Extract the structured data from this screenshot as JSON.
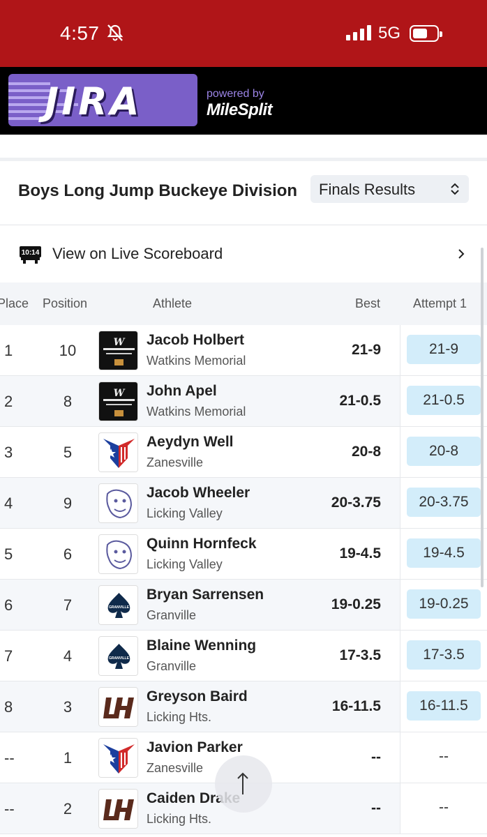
{
  "status_bar": {
    "time": "4:57",
    "network": "5G"
  },
  "brand": {
    "logo_text": "JIRA",
    "powered_by": "powered by",
    "partner": "MileSplit"
  },
  "event": {
    "title": "Boys Long Jump Buckeye Division",
    "result_type": "Finals Results",
    "live_scoreboard": {
      "label": "View on Live Scoreboard",
      "icon_time": "10:14"
    }
  },
  "table": {
    "headers": {
      "place": "Place",
      "position": "Position",
      "athlete": "Athlete",
      "best": "Best",
      "attempt": "Attempt 1"
    },
    "rows": [
      {
        "place": "1",
        "position": "10",
        "name": "Jacob Holbert",
        "team": "Watkins Memorial",
        "best": "21-9",
        "attempt": "21-9",
        "logo": "warriors-logo"
      },
      {
        "place": "2",
        "position": "8",
        "name": "John Apel",
        "team": "Watkins Memorial",
        "best": "21-0.5",
        "attempt": "21-0.5",
        "logo": "warriors-logo"
      },
      {
        "place": "3",
        "position": "5",
        "name": "Aeydyn Well",
        "team": "Zanesville",
        "best": "20-8",
        "attempt": "20-8",
        "logo": "zanesville-logo"
      },
      {
        "place": "4",
        "position": "9",
        "name": "Jacob Wheeler",
        "team": "Licking Valley",
        "best": "20-3.75",
        "attempt": "20-3.75",
        "logo": "panther-logo"
      },
      {
        "place": "5",
        "position": "6",
        "name": "Quinn Hornfeck",
        "team": "Licking Valley",
        "best": "19-4.5",
        "attempt": "19-4.5",
        "logo": "panther-logo"
      },
      {
        "place": "6",
        "position": "7",
        "name": "Bryan Sarrensen",
        "team": "Granville",
        "best": "19-0.25",
        "attempt": "19-0.25",
        "logo": "granville-logo"
      },
      {
        "place": "7",
        "position": "4",
        "name": "Blaine Wenning",
        "team": "Granville",
        "best": "17-3.5",
        "attempt": "17-3.5",
        "logo": "granville-logo"
      },
      {
        "place": "8",
        "position": "3",
        "name": "Greyson Baird",
        "team": "Licking Hts.",
        "best": "16-11.5",
        "attempt": "16-11.5",
        "logo": "lh-logo"
      },
      {
        "place": "--",
        "position": "1",
        "name": "Javion Parker",
        "team": "Zanesville",
        "best": "--",
        "attempt": "--",
        "logo": "zanesville-logo"
      },
      {
        "place": "--",
        "position": "2",
        "name": "Caiden Drake",
        "team": "Licking Hts.",
        "best": "--",
        "attempt": "--",
        "logo": "lh-logo"
      }
    ]
  },
  "colors": {
    "status_bar": "#b01518",
    "brand_bar": "#000000",
    "logo_purple": "#7a5fc8",
    "attempt_chip": "#d3edfa"
  }
}
